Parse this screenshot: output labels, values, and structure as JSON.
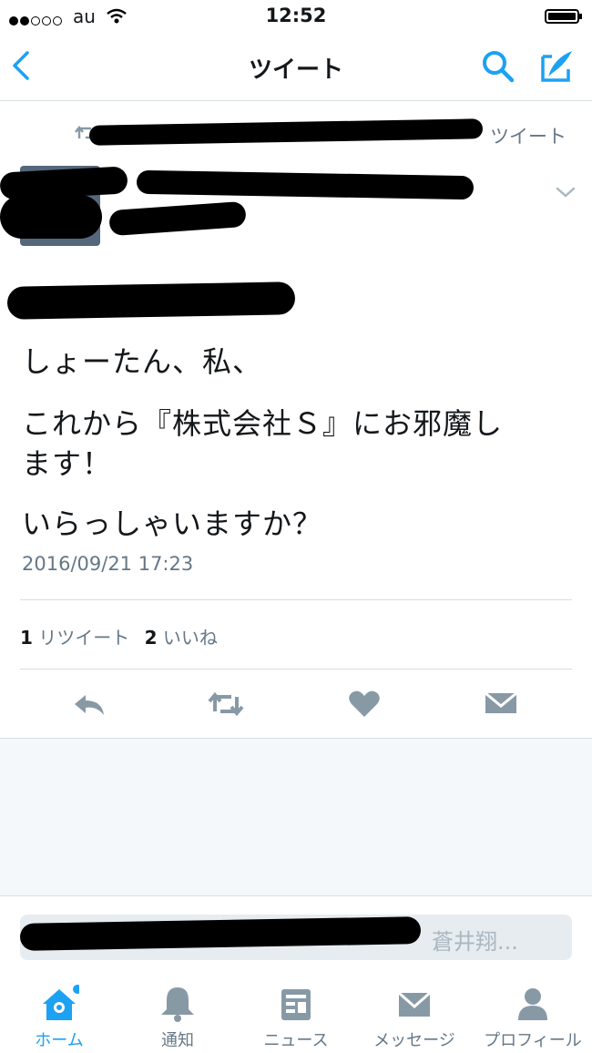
{
  "status_bar": {
    "carrier": "au",
    "time": "12:52"
  },
  "nav": {
    "title": "ツイート"
  },
  "retweet_context": {
    "suffix": "ツイート"
  },
  "tweet": {
    "lines": [
      "しょーたん、私、",
      "これから『株式会社Ｓ』にお邪魔し",
      "ます！",
      "いらっしゃいますか？"
    ],
    "timestamp": "2016/09/21 17:23"
  },
  "stats": {
    "retweets": "1",
    "retweets_label": "リツイート",
    "likes": "2",
    "likes_label": "いいね"
  },
  "reply": {
    "placeholder": "蒼井翔..."
  },
  "tabs": [
    {
      "label": "ホーム",
      "icon": "home-icon",
      "active": true
    },
    {
      "label": "通知",
      "icon": "bell-icon",
      "active": false
    },
    {
      "label": "ニュース",
      "icon": "news-icon",
      "active": false
    },
    {
      "label": "メッセージ",
      "icon": "envelope-icon",
      "active": false
    },
    {
      "label": "プロフィール",
      "icon": "person-icon",
      "active": false
    }
  ],
  "colors": {
    "accent": "#1da1f2",
    "gray_text": "#657786",
    "icon_gray": "#8899a6",
    "background": "#f5f8fa"
  }
}
